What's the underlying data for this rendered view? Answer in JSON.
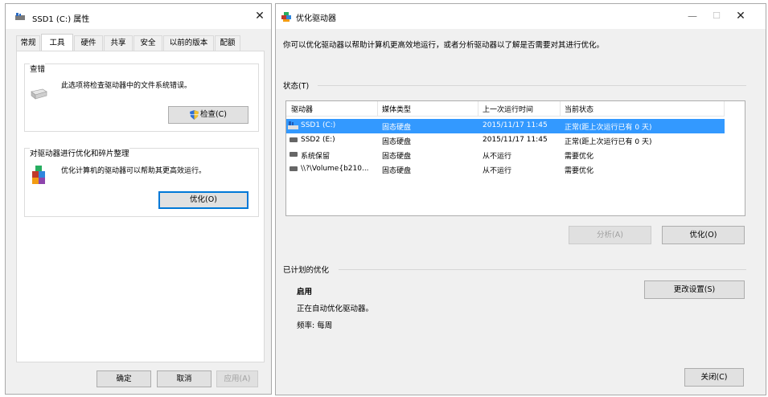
{
  "props_dialog": {
    "title": "SSD1 (C:) 属性",
    "close_glyph": "✕",
    "tabs": [
      "常规",
      "工具",
      "硬件",
      "共享",
      "安全",
      "以前的版本",
      "配额"
    ],
    "active_tab": "工具",
    "error_check": {
      "title": "查错",
      "text": "此选项将检查驱动器中的文件系统错误。",
      "button": "检查(C)"
    },
    "optimize": {
      "title": "对驱动器进行优化和碎片整理",
      "text": "优化计算机的驱动器可以帮助其更高效运行。",
      "button": "优化(O)"
    },
    "footer": {
      "ok": "确定",
      "cancel": "取消",
      "apply": "应用(A)"
    }
  },
  "optimize_window": {
    "title": "优化驱动器",
    "minimize_glyph": "—",
    "maximize_glyph": "☐",
    "close_glyph": "✕",
    "intro": "你可以优化驱动器以帮助计算机更高效地运行，或者分析驱动器以了解是否需要对其进行优化。",
    "status_label": "状态(T)",
    "columns": [
      "驱动器",
      "媒体类型",
      "上一次运行时间",
      "当前状态"
    ],
    "drives": [
      {
        "name": "SSD1 (C:)",
        "media": "固态硬盘",
        "last_run": "2015/11/17 11:45",
        "status": "正常(距上次运行已有 0 天)",
        "selected": true
      },
      {
        "name": "SSD2 (E:)",
        "media": "固态硬盘",
        "last_run": "2015/11/17 11:45",
        "status": "正常(距上次运行已有 0 天)",
        "selected": false
      },
      {
        "name": "系统保留",
        "media": "固态硬盘",
        "last_run": "从不运行",
        "status": "需要优化",
        "selected": false
      },
      {
        "name": "\\\\?\\Volume{b210...",
        "media": "固态硬盘",
        "last_run": "从不运行",
        "status": "需要优化",
        "selected": false
      }
    ],
    "analyze_button": "分析(A)",
    "optimize_button": "优化(O)",
    "scheduled": {
      "label": "已计划的优化",
      "state": "启用",
      "description": "正在自动优化驱动器。",
      "frequency": "频率: 每周",
      "change_button": "更改设置(S)"
    },
    "close_button": "关闭(C)"
  },
  "colors": {
    "selection": "#3399ff",
    "focus_border": "#0078d7",
    "dialog_bg": "#f0f0f0"
  }
}
